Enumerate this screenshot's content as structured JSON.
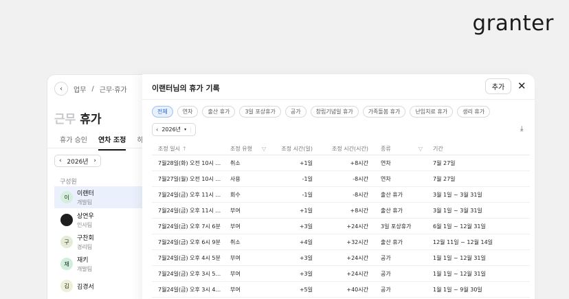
{
  "brand": {
    "logo_text": "granter"
  },
  "app": {
    "breadcrumb": {
      "back_icon": "chevron-left-icon",
      "section": "업무",
      "separator": "/",
      "current": "근무·휴가"
    },
    "title": {
      "muted": "근무",
      "main": "휴가"
    },
    "tabs": [
      "휴가 승인",
      "연차 조정",
      "히스토"
    ],
    "year": "2026년",
    "members_label": "구성원",
    "members": [
      {
        "initial": "이",
        "name": "이랜터",
        "team": "개발팀",
        "color": "#d6efdc"
      },
      {
        "initial": "",
        "name": "상연우",
        "team": "인사팀",
        "color": "#1e1e1e"
      },
      {
        "initial": "구",
        "name": "구찬회",
        "team": "경리팀",
        "color": "#e4ecd6"
      },
      {
        "initial": "재",
        "name": "재키",
        "team": "개발팀",
        "color": "#cfeedd"
      },
      {
        "initial": "김",
        "name": "김경서",
        "team": "",
        "color": "#efefd8"
      }
    ]
  },
  "modal": {
    "title": "이랜터님의 휴가 기록",
    "add_label": "추가",
    "close_icon": "close-icon",
    "chips": [
      "전체",
      "연차",
      "출산 휴가",
      "3일 포상휴가",
      "공가",
      "창립기념일 휴가",
      "가족돌봄 휴가",
      "난임치료 휴가",
      "생리 휴가"
    ],
    "year": "2026년",
    "download_icon": "download-icon",
    "columns": [
      "조정 일시",
      "조정 유형",
      "조정 시간(일)",
      "조정 시간(시간)",
      "종류",
      "기간"
    ],
    "rows": [
      [
        "7월28일(화) 오전 10시 ...",
        "취소",
        "+1일",
        "+8시간",
        "연차",
        "7월 27일"
      ],
      [
        "7월27일(월) 오전 10시 ...",
        "사용",
        "-1일",
        "-8시간",
        "연차",
        "7월 27일"
      ],
      [
        "7월24일(금) 오후 11시 ...",
        "회수",
        "-1일",
        "-8시간",
        "출산 휴가",
        "3월 1일 ~ 3월 31일"
      ],
      [
        "7월24일(금) 오후 11시 ...",
        "부여",
        "+1일",
        "+8시간",
        "출산 휴가",
        "3월 1일 ~ 3월 31일"
      ],
      [
        "7월24일(금) 오후 7시 6분",
        "부여",
        "+3일",
        "+24시간",
        "3일 포상휴가",
        "6월 1일 ~ 12월 31일"
      ],
      [
        "7월24일(금) 오후 6시 9분",
        "취소",
        "+4일",
        "+32시간",
        "출산 휴가",
        "12월 11일 ~ 12월 14일"
      ],
      [
        "7월24일(금) 오후 4시 5분",
        "부여",
        "+3일",
        "+24시간",
        "공가",
        "1월 1일 ~ 12월 31일"
      ],
      [
        "7월24일(금) 오후 3시 5...",
        "부여",
        "+3일",
        "+24시간",
        "공가",
        "1월 1일 ~ 12월 31일"
      ],
      [
        "7월24일(금) 오후 3시 4...",
        "부여",
        "+5일",
        "+40시간",
        "공가",
        "1월 1일 ~ 9월 30일"
      ]
    ]
  }
}
